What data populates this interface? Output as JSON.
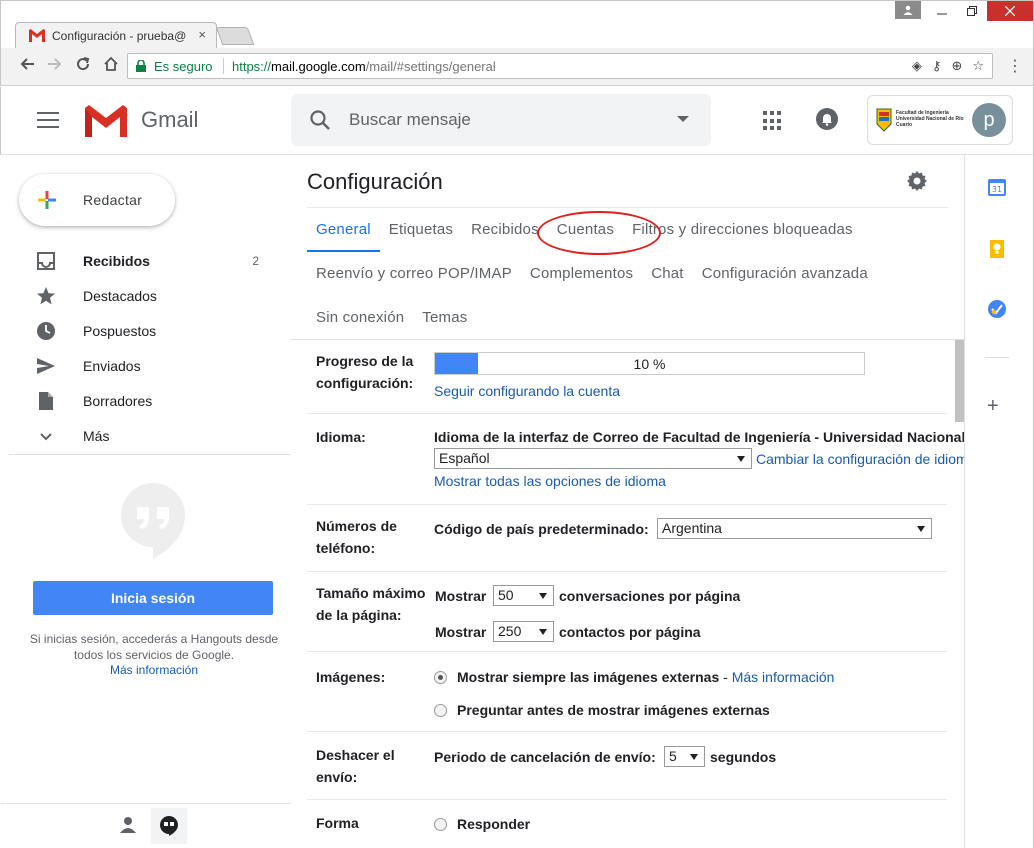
{
  "browser": {
    "tab_title": "Configuración - prueba@",
    "tab_close": "×",
    "secure_label": "Es seguro",
    "url_scheme": "https://",
    "url_host": "mail.google.com",
    "url_path": "/mail/#settings/general"
  },
  "header": {
    "app_name": "Gmail",
    "search_placeholder": "Buscar mensaje",
    "org_text": "Facultad de Ingeniería Universidad Nacional de Río Cuarto",
    "avatar_letter": "p"
  },
  "sidebar": {
    "compose_label": "Redactar",
    "items": [
      {
        "label": "Recibidos",
        "count": "2",
        "icon": "inbox-icon"
      },
      {
        "label": "Destacados",
        "count": "",
        "icon": "star-icon"
      },
      {
        "label": "Pospuestos",
        "count": "",
        "icon": "clock-icon"
      },
      {
        "label": "Enviados",
        "count": "",
        "icon": "send-icon"
      },
      {
        "label": "Borradores",
        "count": "",
        "icon": "draft-icon"
      },
      {
        "label": "Más",
        "count": "",
        "icon": "chevron-down-icon"
      }
    ],
    "hangouts": {
      "signin_label": "Inicia sesión",
      "description": "Si inicias sesión, accederás a Hangouts desde todos los servicios de Google.",
      "more_info": "Más información"
    }
  },
  "settings": {
    "title": "Configuración",
    "tabs_row1": [
      "General",
      "Etiquetas",
      "Recibidos",
      "Cuentas",
      "Filtros y direcciones bloqueadas"
    ],
    "tabs_row2": [
      "Reenvío y correo POP/IMAP",
      "Complementos",
      "Chat",
      "Configuración avanzada"
    ],
    "tabs_row3": [
      "Sin conexión",
      "Temas"
    ],
    "active_tab": "General",
    "progress": {
      "label": "Progreso de la configuración:",
      "percent": 10,
      "percent_text": "10 %",
      "link": "Seguir configurando la cuenta"
    },
    "language": {
      "label": "Idioma:",
      "heading": "Idioma de la interfaz de Correo de Facultad de Ingeniería - Universidad Nacional de Río Cuarto:",
      "selected": "Español",
      "change_link": "Cambiar la configuración de idioma de otros productos de Google",
      "all_options_link": "Mostrar todas las opciones de idioma"
    },
    "phone": {
      "label": "Números de teléfono:",
      "field_label": "Código de país predeterminado:",
      "selected": "Argentina"
    },
    "page_size": {
      "label": "Tamaño máximo de la página:",
      "show1": "Mostrar",
      "conversations_value": "50",
      "conversations_suffix": "conversaciones por página",
      "show2": "Mostrar",
      "contacts_value": "250",
      "contacts_suffix": "contactos por página"
    },
    "images": {
      "label": "Imágenes:",
      "option1": "Mostrar siempre las imágenes externas",
      "option1_sep": " - ",
      "option1_link": "Más información",
      "option2": "Preguntar antes de mostrar imágenes externas"
    },
    "undo": {
      "label": "Deshacer el envío:",
      "field_label": "Periodo de cancelación de envío:",
      "value": "5",
      "suffix": "segundos"
    },
    "reply": {
      "label": "Forma",
      "option1": "Responder"
    }
  },
  "colors": {
    "accent": "#1a73e8",
    "link": "#1a5ab0",
    "annotation": "#e02020",
    "signin": "#4285f4"
  }
}
